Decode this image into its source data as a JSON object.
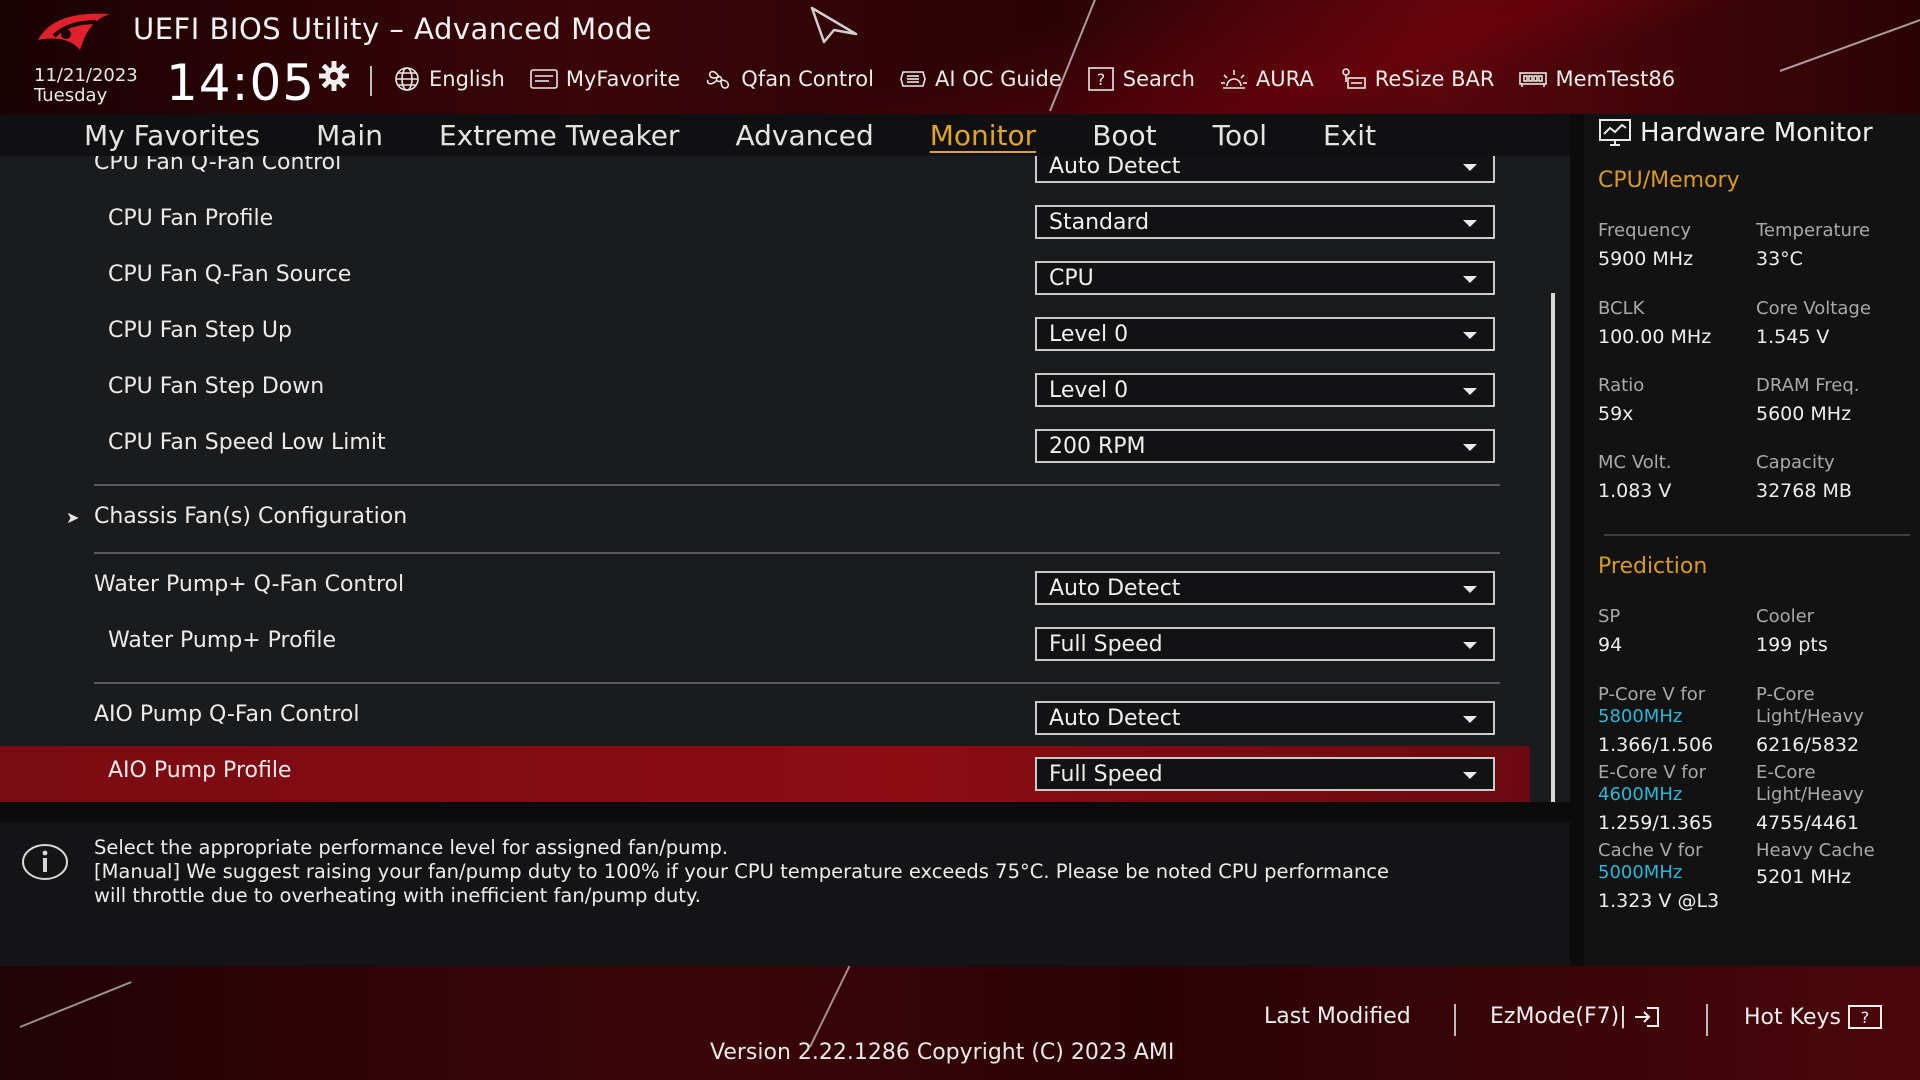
{
  "header": {
    "title": "UEFI BIOS Utility – Advanced Mode",
    "date": "11/21/2023",
    "day": "Tuesday",
    "time": "14:05",
    "toolbar": [
      {
        "label": "English",
        "icon": "globe-icon"
      },
      {
        "label": "MyFavorite",
        "icon": "favorite-icon"
      },
      {
        "label": "Qfan Control",
        "icon": "fan-icon"
      },
      {
        "label": "AI OC Guide",
        "icon": "ai-chip-icon"
      },
      {
        "label": "Search",
        "icon": "help-question-icon"
      },
      {
        "label": "AURA",
        "icon": "aura-light-icon"
      },
      {
        "label": "ReSize BAR",
        "icon": "resize-bar-icon"
      },
      {
        "label": "MemTest86",
        "icon": "memory-icon"
      }
    ]
  },
  "nav": {
    "tabs": [
      "My Favorites",
      "Main",
      "Extreme Tweaker",
      "Advanced",
      "Monitor",
      "Boot",
      "Tool",
      "Exit"
    ],
    "active": "Monitor"
  },
  "settings": {
    "cut_row": {
      "label": "CPU Fan Q-Fan Control",
      "value": "Auto Detect"
    },
    "rows": [
      {
        "label": "CPU Fan Profile",
        "value": "Standard"
      },
      {
        "label": "CPU Fan Q-Fan Source",
        "value": "CPU"
      },
      {
        "label": "CPU Fan Step Up",
        "value": "Level 0"
      },
      {
        "label": "CPU Fan Step Down",
        "value": "Level 0"
      },
      {
        "label": "CPU Fan Speed Low Limit",
        "value": "200 RPM"
      }
    ],
    "chassis": {
      "label": "Chassis Fan(s) Configuration",
      "arrow": "➤"
    },
    "water_pump": {
      "control": {
        "label": "Water Pump+ Q-Fan Control",
        "value": "Auto Detect"
      },
      "profile": {
        "label": "Water Pump+ Profile",
        "value": "Full Speed"
      }
    },
    "aio_pump": {
      "control": {
        "label": "AIO Pump Q-Fan Control",
        "value": "Auto Detect"
      },
      "profile": {
        "label": "AIO Pump Profile",
        "value": "Full Speed"
      }
    }
  },
  "help": {
    "line1": "Select the appropriate performance level for assigned fan/pump.",
    "line2": "[Manual] We suggest raising your fan/pump duty to 100% if your CPU temperature exceeds 75°C. Please be noted CPU performance",
    "line3": "will throttle due to overheating with inefficient fan/pump duty."
  },
  "hardware_monitor": {
    "title": "Hardware Monitor",
    "cpu_memory": {
      "section": "CPU/Memory",
      "items": [
        {
          "label": "Frequency",
          "value": "5900 MHz"
        },
        {
          "label": "Temperature",
          "value": "33°C"
        },
        {
          "label": "BCLK",
          "value": "100.00 MHz"
        },
        {
          "label": "Core Voltage",
          "value": "1.545 V"
        },
        {
          "label": "Ratio",
          "value": "59x"
        },
        {
          "label": "DRAM Freq.",
          "value": "5600 MHz"
        },
        {
          "label": "MC Volt.",
          "value": "1.083 V"
        },
        {
          "label": "Capacity",
          "value": "32768 MB"
        }
      ]
    },
    "prediction": {
      "section": "Prediction",
      "sp_label": "SP",
      "sp_value": "94",
      "cooler_label": "Cooler",
      "cooler_value": "199 pts",
      "pcore_v_label": "P-Core V for",
      "pcore_v_freq": "5800MHz",
      "pcore_v_value": "1.366/1.506",
      "pcore_lh_label1": "P-Core",
      "pcore_lh_label2": "Light/Heavy",
      "pcore_lh_value": "6216/5832",
      "ecore_v_label": "E-Core V for",
      "ecore_v_freq": "4600MHz",
      "ecore_v_value": "1.259/1.365",
      "ecore_lh_label1": "E-Core",
      "ecore_lh_label2": "Light/Heavy",
      "ecore_lh_value": "4755/4461",
      "cache_v_label": "Cache V for",
      "cache_v_freq": "5000MHz",
      "cache_v_value": "1.323 V @L3",
      "heavy_cache_label": "Heavy Cache",
      "heavy_cache_value": "5201 MHz"
    }
  },
  "footer": {
    "last_modified": "Last Modified",
    "ezmode": "EzMode(F7)|",
    "hotkeys": "Hot Keys",
    "version": "Version 2.22.1286 Copyright (C) 2023 AMI"
  },
  "colors": {
    "accent": "#e0a526",
    "highlight": "#8c0c14",
    "cyan": "#2fb6d6"
  }
}
